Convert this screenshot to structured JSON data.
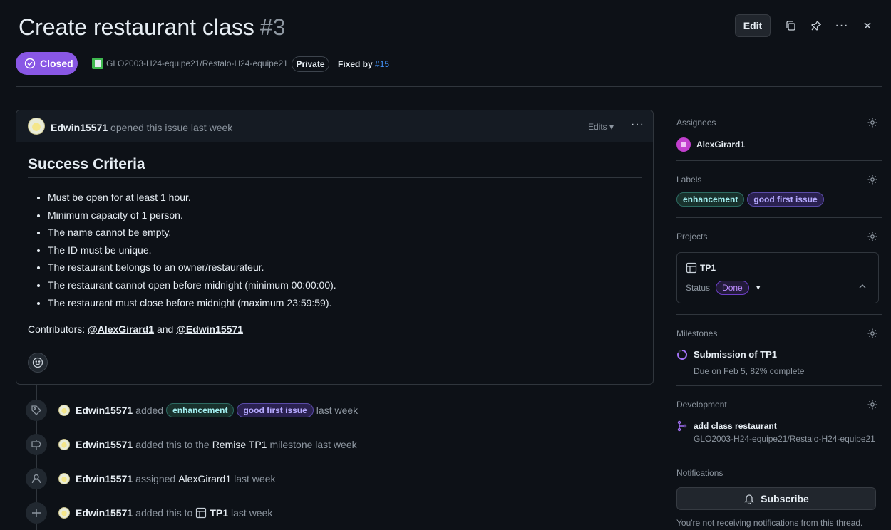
{
  "header": {
    "title": "Create restaurant class",
    "number": "#3",
    "edit_label": "Edit",
    "state": "Closed",
    "repo": "GLO2003-H24-equipe21/Restalo-H24-equipe21",
    "visibility": "Private",
    "fixed_by_label": "Fixed by",
    "fixed_by_link": "#15"
  },
  "comment": {
    "author": "Edwin15571",
    "action": "opened this issue last week",
    "edits_label": "Edits",
    "heading": "Success Criteria",
    "items": [
      "Must be open for at least 1 hour.",
      "Minimum capacity of 1 person.",
      "The name cannot be empty.",
      "The ID must be unique.",
      "The restaurant belongs to an owner/restaurateur.",
      "The restaurant cannot open before midnight (minimum 00:00:00).",
      "The restaurant must close before midnight (maximum 23:59:59)."
    ],
    "contributors_label": "Contributors:",
    "contributor1": "@AlexGirard1",
    "and": "and",
    "contributor2": "@Edwin15571"
  },
  "timeline": [
    {
      "author": "Edwin15571",
      "verb": "added",
      "label1": "enhancement",
      "label2": "good first issue",
      "time": "last week"
    },
    {
      "author": "Edwin15571",
      "pre": "added this to the",
      "target": "Remise TP1",
      "post": "milestone last week"
    },
    {
      "author": "Edwin15571",
      "pre": "assigned",
      "target": "AlexGirard1",
      "post": "last week"
    },
    {
      "author": "Edwin15571",
      "pre": "added this to",
      "target": "TP1",
      "post": "last week"
    }
  ],
  "sidebar": {
    "assignees_title": "Assignees",
    "assignee": "AlexGirard1",
    "labels_title": "Labels",
    "labels": [
      "enhancement",
      "good first issue"
    ],
    "projects_title": "Projects",
    "project_name": "TP1",
    "status_label": "Status",
    "status_value": "Done",
    "milestones_title": "Milestones",
    "milestone_name": "Submission of TP1",
    "milestone_due": "Due on Feb 5, 82% complete",
    "development_title": "Development",
    "dev_branch": "add class restaurant",
    "dev_repo": "GLO2003-H24-equipe21/Restalo-H24-equipe21",
    "notifications_title": "Notifications",
    "subscribe_label": "Subscribe",
    "notif_text": "You're not receiving notifications from this thread."
  },
  "colors": {
    "closed": "#8957e5",
    "link": "#4493f8",
    "background": "#0d1117"
  }
}
